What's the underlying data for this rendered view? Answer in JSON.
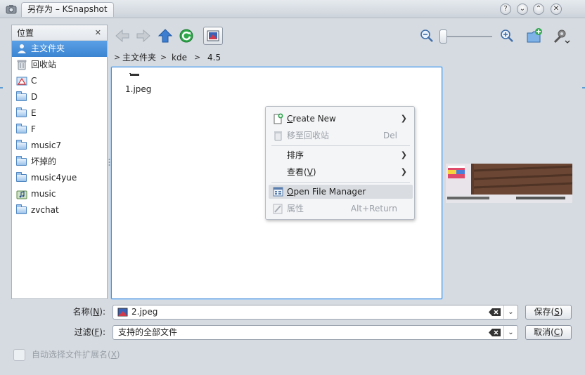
{
  "window": {
    "title": "另存为 – KSnapshot"
  },
  "places": {
    "header": "位置",
    "items": [
      {
        "label": "主文件夹",
        "icon": "home-icon",
        "active": true
      },
      {
        "label": "回收站",
        "icon": "trash-icon"
      },
      {
        "label": "C",
        "icon": "drive-warning-icon"
      },
      {
        "label": "D",
        "icon": "folder-icon"
      },
      {
        "label": "E",
        "icon": "folder-icon"
      },
      {
        "label": "F",
        "icon": "folder-icon"
      },
      {
        "label": "music7",
        "icon": "folder-icon"
      },
      {
        "label": "坏掉的",
        "icon": "folder-icon"
      },
      {
        "label": "music4yue",
        "icon": "folder-icon"
      },
      {
        "label": "music",
        "icon": "music-folder-icon"
      },
      {
        "label": "zvchat",
        "icon": "folder-icon"
      }
    ]
  },
  "breadcrumb": {
    "items": [
      "主文件夹",
      "kde",
      "4.5"
    ]
  },
  "fileview": {
    "files": [
      {
        "name": "1.jpeg"
      }
    ]
  },
  "context_menu": {
    "create_new": {
      "accel": "C",
      "rest": "reate New"
    },
    "move_to_trash": {
      "label": "移至回收站",
      "shortcut": "Del"
    },
    "sort": {
      "label": "排序"
    },
    "view": {
      "label": "查看(",
      "accel": "V",
      "end": ")"
    },
    "open_file_manager": {
      "accel": "O",
      "rest": "pen File Manager"
    },
    "properties": {
      "label": "属性",
      "shortcut": "Alt+Return"
    }
  },
  "form": {
    "name_label": {
      "prefix": "名称(",
      "accel": "N",
      "suffix": "):"
    },
    "name_value": "2.jpeg",
    "filter_label": {
      "prefix": "过滤(",
      "accel": "F",
      "suffix": "):"
    },
    "filter_value": "支持的全部文件",
    "save": {
      "prefix": "保存(",
      "accel": "S",
      "suffix": ")"
    },
    "cancel": {
      "prefix": "取消(",
      "accel": "C",
      "suffix": ")"
    },
    "auto_ext": {
      "prefix": "自动选择文件扩展名(",
      "accel": "X",
      "suffix": ")"
    }
  },
  "colors": {
    "accent": "#3b84d1",
    "focus_border": "#4a90d9",
    "refresh_green": "#2ea84a"
  }
}
